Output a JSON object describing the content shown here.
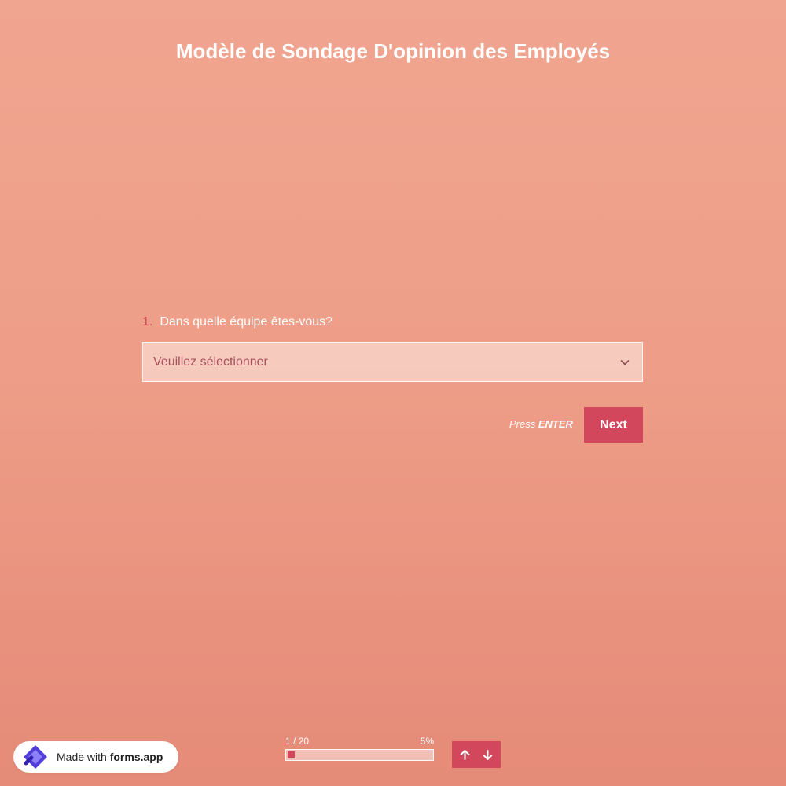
{
  "form": {
    "title": "Modèle de Sondage D'opinion des Employés"
  },
  "question": {
    "number": "1.",
    "text": "Dans quelle équipe êtes-vous?",
    "select_placeholder": "Veuillez sélectionner",
    "select_icon": "chevron-down-icon"
  },
  "actions": {
    "press_hint_prefix": "Press",
    "press_hint_key": "ENTER",
    "next_label": "Next"
  },
  "badge": {
    "logo_icon": "forms-app-logo-icon",
    "prefix": "Made with",
    "brand": "forms.app"
  },
  "progress": {
    "position": "1 / 20",
    "percent_label": "5%",
    "fraction": 0.05
  },
  "navigation": {
    "up_icon": "arrow-up-icon",
    "down_icon": "arrow-down-icon"
  },
  "colors": {
    "accent": "#d2475b",
    "background": "#ee9e88"
  }
}
